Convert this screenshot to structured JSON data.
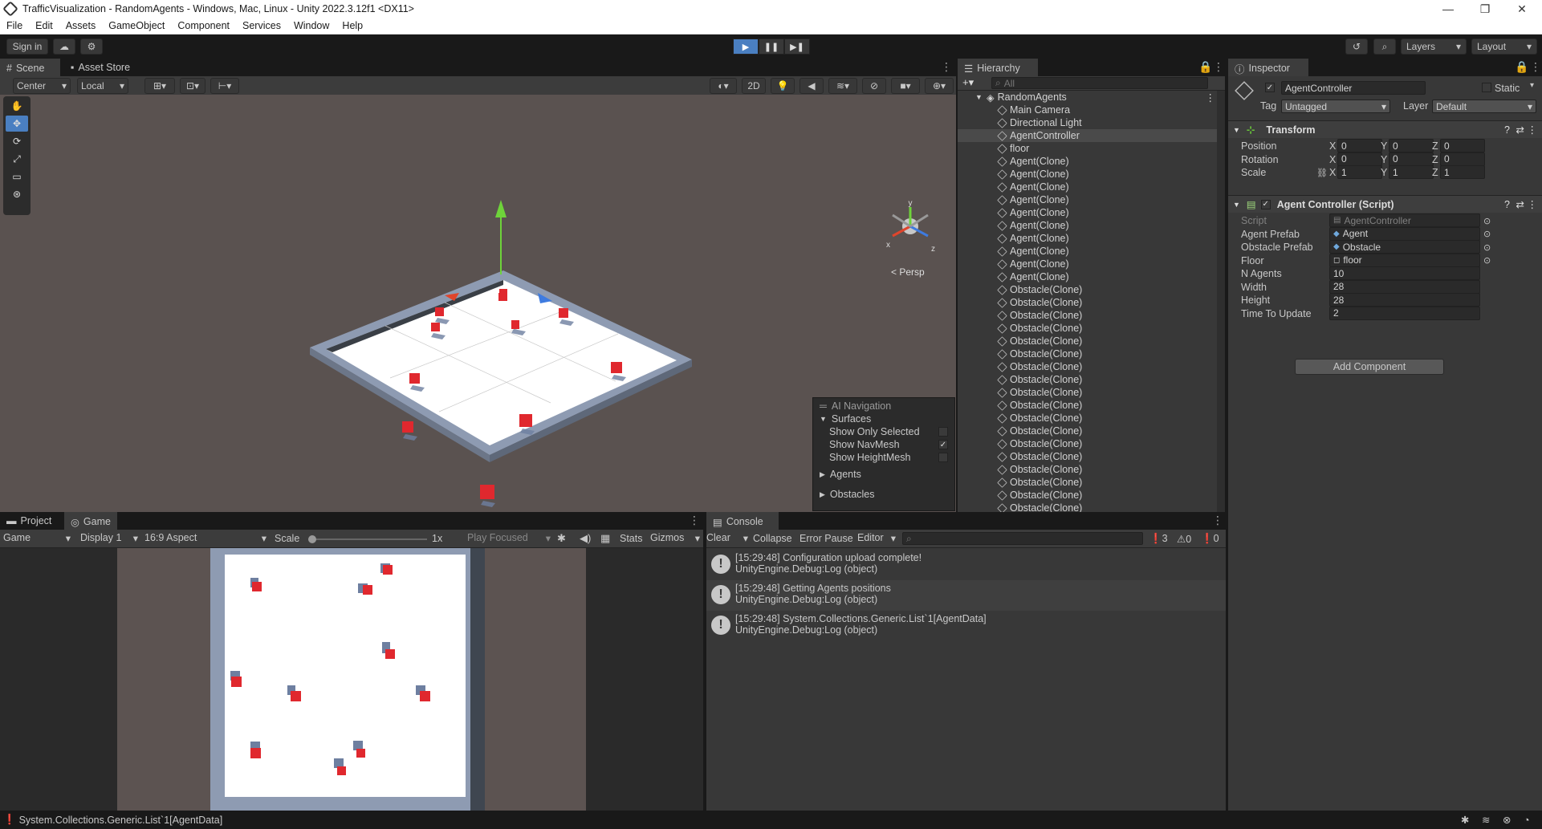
{
  "window": {
    "title": "TrafficVisualization - RandomAgents - Windows, Mac, Linux - Unity 2022.3.12f1 <DX11>",
    "minimize": "—",
    "maximize": "❐",
    "close": "✕"
  },
  "menu": [
    "File",
    "Edit",
    "Assets",
    "GameObject",
    "Component",
    "Services",
    "Window",
    "Help"
  ],
  "toolbar": {
    "sign_in": "Sign in",
    "layers": "Layers",
    "layout": "Layout"
  },
  "scene": {
    "tabs": [
      "Scene",
      "Asset Store"
    ],
    "pivot": "Center",
    "space": "Local",
    "mode_2d": "2D",
    "persp": "< Persp",
    "gizmo_axes": {
      "x": "x",
      "y": "y",
      "z": "z"
    }
  },
  "ai_navigation": {
    "title": "AI Navigation",
    "surfaces": "Surfaces",
    "show_only_selected": "Show Only Selected",
    "show_navmesh": "Show NavMesh",
    "show_heightmesh": "Show HeightMesh",
    "agents": "Agents",
    "obstacles": "Obstacles",
    "navmesh_checked": "✓"
  },
  "hierarchy": {
    "tab": "Hierarchy",
    "search_placeholder": "All",
    "root": "RandomAgents",
    "items": [
      "Main Camera",
      "Directional Light",
      "AgentController",
      "floor",
      "Agent(Clone)",
      "Agent(Clone)",
      "Agent(Clone)",
      "Agent(Clone)",
      "Agent(Clone)",
      "Agent(Clone)",
      "Agent(Clone)",
      "Agent(Clone)",
      "Agent(Clone)",
      "Agent(Clone)",
      "Obstacle(Clone)",
      "Obstacle(Clone)",
      "Obstacle(Clone)",
      "Obstacle(Clone)",
      "Obstacle(Clone)",
      "Obstacle(Clone)",
      "Obstacle(Clone)",
      "Obstacle(Clone)",
      "Obstacle(Clone)",
      "Obstacle(Clone)",
      "Obstacle(Clone)",
      "Obstacle(Clone)",
      "Obstacle(Clone)",
      "Obstacle(Clone)",
      "Obstacle(Clone)",
      "Obstacle(Clone)",
      "Obstacle(Clone)",
      "Obstacle(Clone)"
    ],
    "selected_index": 2
  },
  "inspector": {
    "tab": "Inspector",
    "object_name": "AgentController",
    "static_label": "Static",
    "tag_label": "Tag",
    "tag_value": "Untagged",
    "layer_label": "Layer",
    "layer_value": "Default",
    "transform": {
      "title": "Transform",
      "rows": [
        {
          "label": "Position",
          "x": "0",
          "y": "0",
          "z": "0"
        },
        {
          "label": "Rotation",
          "x": "0",
          "y": "0",
          "z": "0"
        },
        {
          "label": "Scale",
          "x": "1",
          "y": "1",
          "z": "1"
        }
      ],
      "axis": {
        "x": "X",
        "y": "Y",
        "z": "Z"
      }
    },
    "script_component": {
      "title": "Agent Controller (Script)",
      "rows": [
        {
          "label": "Script",
          "value": "AgentController"
        },
        {
          "label": "Agent Prefab",
          "value": "Agent"
        },
        {
          "label": "Obstacle Prefab",
          "value": "Obstacle"
        },
        {
          "label": "Floor",
          "value": "floor"
        },
        {
          "label": "N Agents",
          "value": "10"
        },
        {
          "label": "Width",
          "value": "28"
        },
        {
          "label": "Height",
          "value": "28"
        },
        {
          "label": "Time To Update",
          "value": "2"
        }
      ]
    },
    "add_component": "Add Component"
  },
  "game": {
    "tabs": [
      "Project",
      "Game"
    ],
    "display_mode": "Game",
    "display": "Display 1",
    "aspect": "16:9 Aspect",
    "scale_label": "Scale",
    "scale_value": "1x",
    "play_focused": "Play Focused",
    "stats": "Stats",
    "gizmos": "Gizmos"
  },
  "console": {
    "tab": "Console",
    "clear": "Clear",
    "collapse": "Collapse",
    "error_pause": "Error Pause",
    "editor": "Editor",
    "counts": {
      "log": "3",
      "warn": "0",
      "error": "0"
    },
    "entries": [
      {
        "line1": "[15:29:48] Configuration upload complete!",
        "line2": "UnityEngine.Debug:Log (object)"
      },
      {
        "line1": "[15:29:48] Getting Agents positions",
        "line2": "UnityEngine.Debug:Log (object)"
      },
      {
        "line1": "[15:29:48] System.Collections.Generic.List`1[AgentData]",
        "line2": "UnityEngine.Debug:Log (object)"
      }
    ]
  },
  "status": {
    "message": "System.Collections.Generic.List`1[AgentData]"
  },
  "colors": {
    "accent": "#4a7fc1",
    "agent_red": "#e0282e",
    "floor_white": "#ffffff",
    "wall": "#8c9bb0"
  }
}
